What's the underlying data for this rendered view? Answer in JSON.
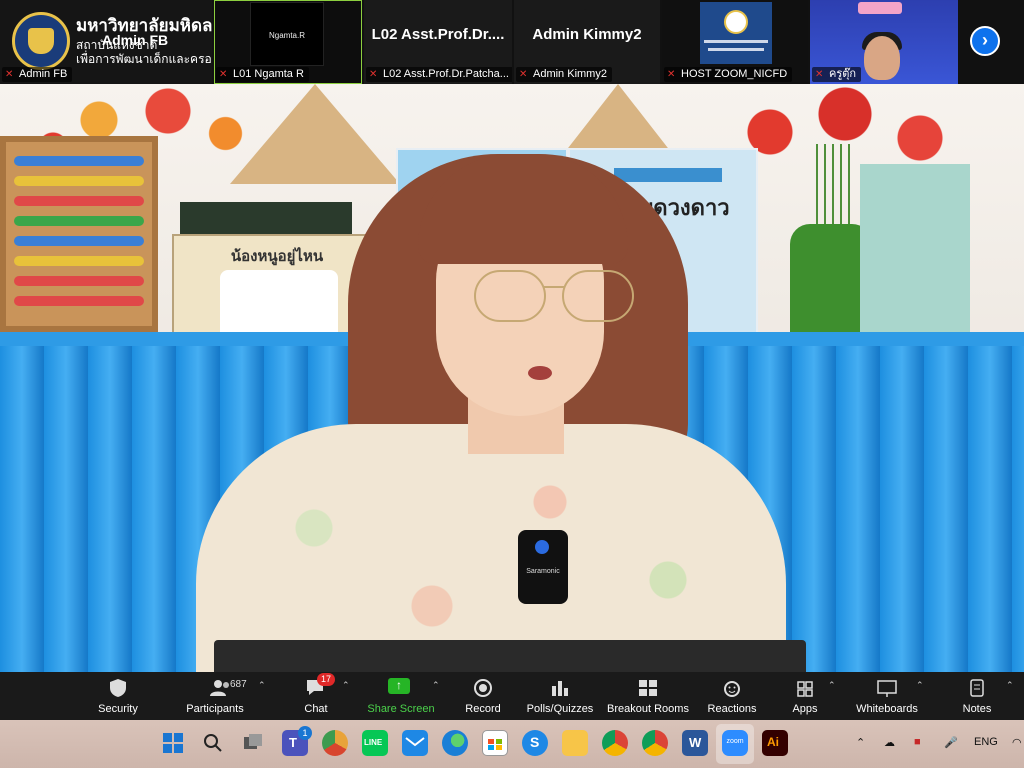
{
  "participants": {
    "tile1": {
      "org_name": "มหาวิทยาลัยมหิดล",
      "institute_line1": "สถาบันแห่งชาติ",
      "institute_line2": "เพื่อการพัฒนาเด็กและครอบครัว",
      "overlay_name": "Admin FB",
      "label": "Admin FB"
    },
    "tile2": {
      "inner_text": "Ngamta.R",
      "label": "L01 Ngamta R"
    },
    "tile3": {
      "display_name": "L02  Asst.Prof.Dr....",
      "label": "L02 Asst.Prof.Dr.Patcha..."
    },
    "tile4": {
      "display_name": "Admin Kimmy2",
      "label": "Admin Kimmy2"
    },
    "tile5": {
      "label": "HOST ZOOM_NICFD"
    },
    "tile6": {
      "label": "ครูตุ๊ก"
    },
    "next_icon": "chevron-right-icon"
  },
  "video": {
    "book_title_1": "น้องหนูอยู่ไหน",
    "book_title_2": "กับดวงดาว",
    "mic_brand": "Saramonic"
  },
  "toolbar": {
    "security": "Security",
    "participants": "Participants",
    "participants_count": "687",
    "chat": "Chat",
    "chat_badge": "17",
    "share_screen": "Share Screen",
    "record": "Record",
    "polls": "Polls/Quizzes",
    "breakout": "Breakout Rooms",
    "reactions": "Reactions",
    "apps": "Apps",
    "whiteboards": "Whiteboards",
    "notes": "Notes"
  },
  "taskbar": {
    "teams_badge": "1",
    "zoom_label": "zoom",
    "language": "ENG",
    "icons": [
      "windows-start-icon",
      "search-icon",
      "task-view-icon",
      "teams-icon",
      "chrome-canary-icon",
      "line-icon",
      "mail-icon",
      "edge-icon",
      "store-icon",
      "skype-icon",
      "file-explorer-icon",
      "chrome-icon",
      "chrome-profile-icon",
      "word-icon",
      "zoom-icon",
      "illustrator-icon"
    ]
  },
  "colors": {
    "zoom_blue": "#0e72ed",
    "share_green": "#26b526",
    "badge_red": "#e02828",
    "muted_mic_red": "#e0322f"
  }
}
